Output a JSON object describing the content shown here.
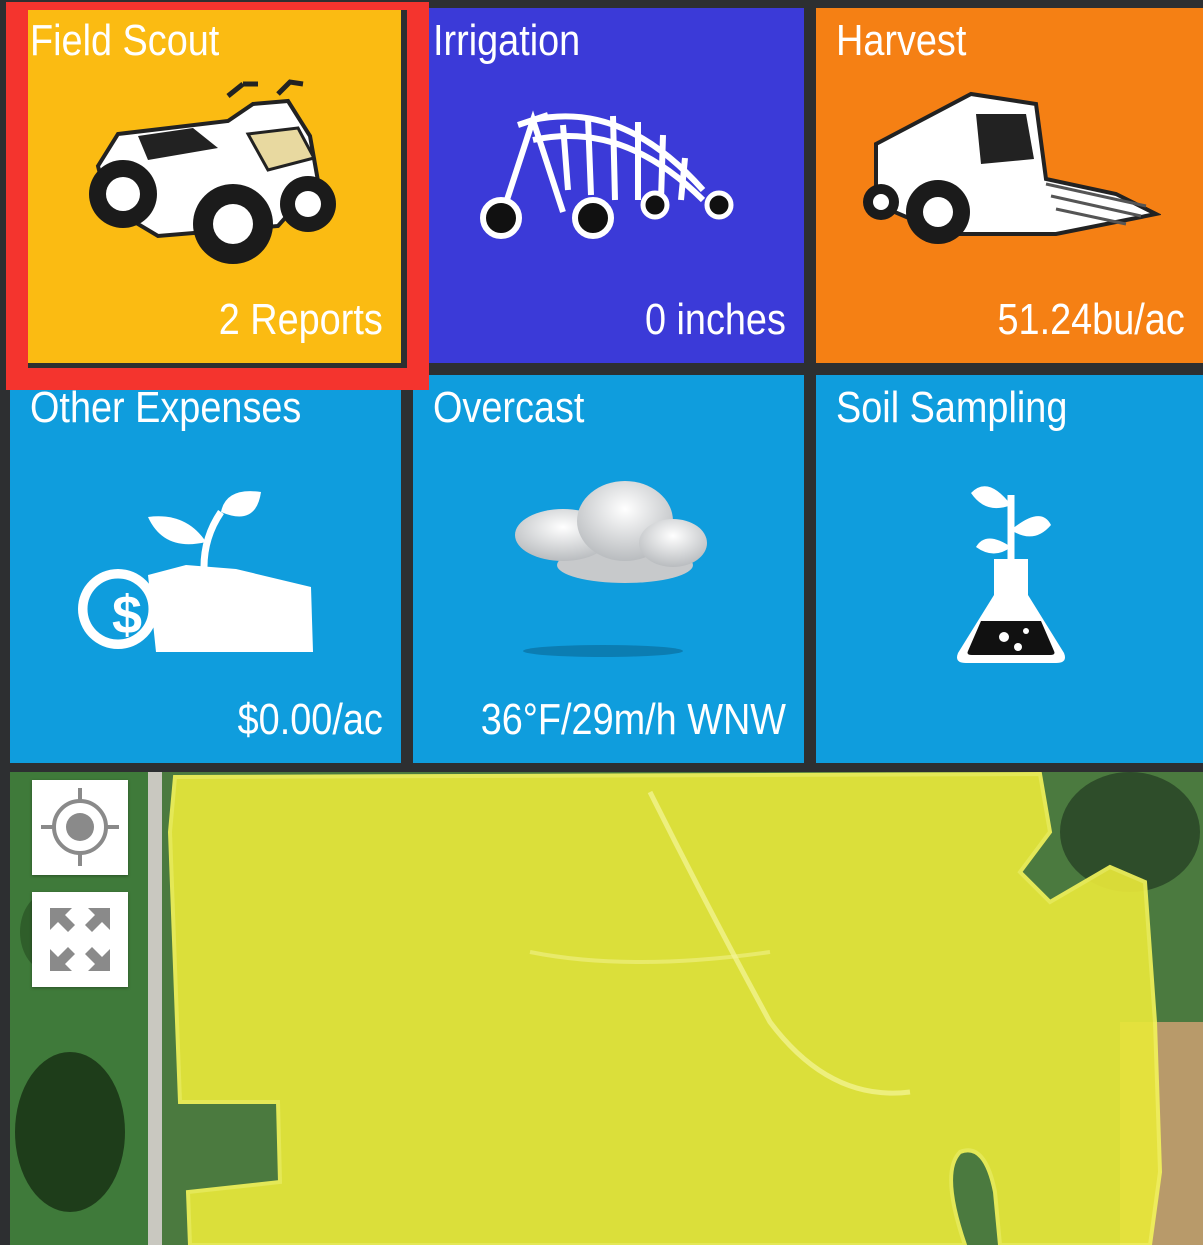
{
  "tiles": [
    {
      "title": "Field Scout",
      "value": "2 Reports",
      "icon": "atv-icon",
      "color": "#fbbb12"
    },
    {
      "title": "Irrigation",
      "value": "0 inches",
      "icon": "center-pivot-icon",
      "color": "#3b3ad8"
    },
    {
      "title": "Harvest",
      "value": "51.24bu/ac",
      "icon": "combine-harvester-icon",
      "color": "#f58014"
    },
    {
      "title": "Other Expenses",
      "value": "$0.00/ac",
      "icon": "money-plant-icon",
      "color": "#0f9ddd"
    },
    {
      "title": "Overcast",
      "value": "36°F/29m/h WNW",
      "icon": "cloud-icon",
      "color": "#0f9ddd"
    },
    {
      "title": "Soil Sampling",
      "value": "",
      "icon": "flask-sprout-icon",
      "color": "#0f9ddd"
    }
  ],
  "selected_tile": "Field Scout",
  "selection_color": "#f4342e",
  "map": {
    "field_overlay_color": "#e8e83a",
    "controls": [
      {
        "name": "locate",
        "icon": "crosshair-icon"
      },
      {
        "name": "fullscreen",
        "icon": "expand-arrows-icon"
      }
    ]
  }
}
